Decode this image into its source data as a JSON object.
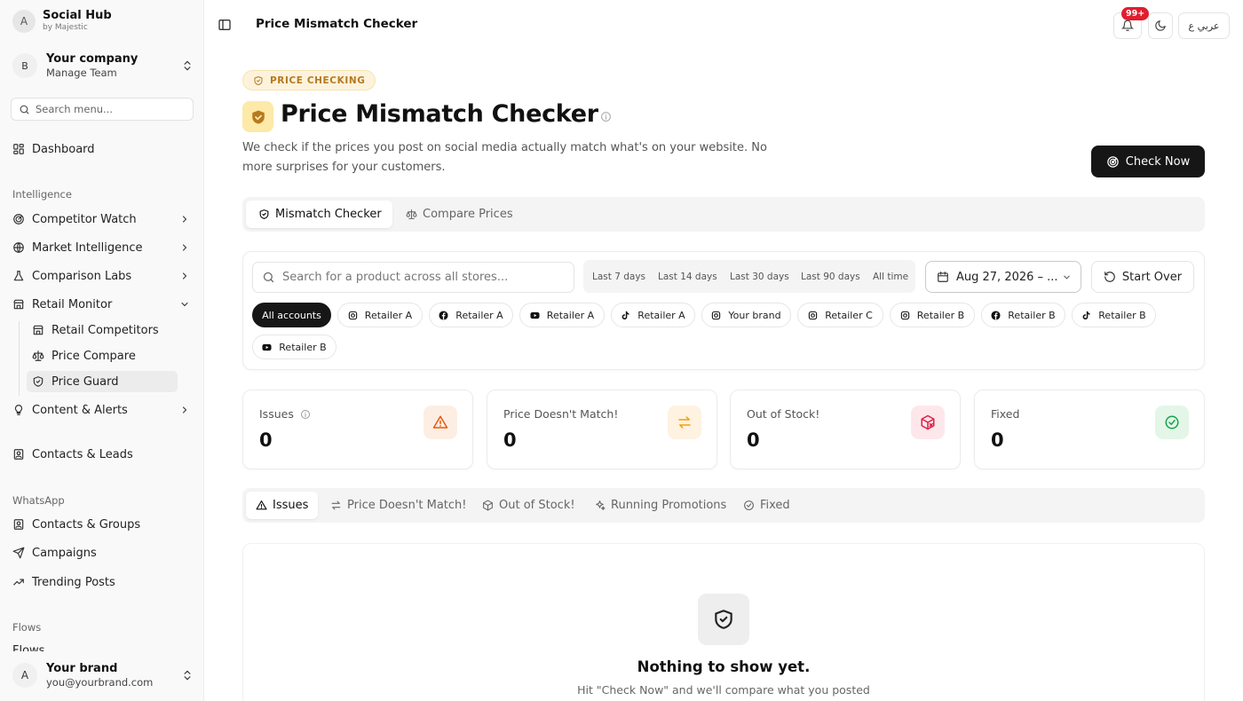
{
  "brand": {
    "avatar": "A",
    "name": "Social Hub",
    "by": "by Majestic"
  },
  "company": {
    "avatar": "B",
    "name": "Your company",
    "sub": "Manage Team"
  },
  "side_search": {
    "placeholder": "Search menu..."
  },
  "nav": {
    "dashboard": "Dashboard",
    "intelligence_label": "Intelligence",
    "competitor_watch": "Competitor Watch",
    "market_intelligence": "Market Intelligence",
    "comparison_labs": "Comparison Labs",
    "retail_monitor": "Retail Monitor",
    "retail_competitors": "Retail Competitors",
    "price_compare": "Price Compare",
    "price_guard": "Price Guard",
    "content_alerts": "Content & Alerts",
    "contacts_leads": "Contacts & Leads",
    "whatsapp_label": "WhatsApp",
    "contacts_groups": "Contacts & Groups",
    "campaigns": "Campaigns",
    "trending_posts": "Trending Posts",
    "flows_label": "Flows",
    "flows_item": "Flows"
  },
  "user": {
    "avatar": "A",
    "name": "Your brand",
    "email": "you@yourbrand.com"
  },
  "header": {
    "title": "Price Mismatch Checker",
    "badge": "99+",
    "lang": "عربي ع"
  },
  "page": {
    "pill": "PRICE CHECKING",
    "title": "Price Mismatch Checker",
    "description": "We check if the prices you post on social media actually match what's on your website. No more surprises for your customers.",
    "check_now": "Check Now"
  },
  "tabs": [
    "Mismatch Checker",
    "Compare Prices"
  ],
  "filters": {
    "search_placeholder": "Search for a product across all stores...",
    "ranges": [
      "Last 7 days",
      "Last 14 days",
      "Last 30 days",
      "Last 90 days",
      "All time"
    ],
    "date": "Aug 27, 2026 – ...",
    "start_over": "Start Over"
  },
  "accounts": [
    {
      "label": "All accounts",
      "icon": "none"
    },
    {
      "label": "Retailer A",
      "icon": "instagram-icon"
    },
    {
      "label": "Retailer A",
      "icon": "facebook-icon"
    },
    {
      "label": "Retailer A",
      "icon": "youtube-icon"
    },
    {
      "label": "Retailer A",
      "icon": "tiktok-icon"
    },
    {
      "label": "Your brand",
      "icon": "instagram-icon"
    },
    {
      "label": "Retailer C",
      "icon": "instagram-icon"
    },
    {
      "label": "Retailer B",
      "icon": "instagram-icon"
    },
    {
      "label": "Retailer B",
      "icon": "facebook-icon"
    },
    {
      "label": "Retailer B",
      "icon": "tiktok-icon"
    },
    {
      "label": "Retailer B",
      "icon": "youtube-icon"
    }
  ],
  "stats": [
    {
      "label": "Issues",
      "value": "0",
      "color": "#ea580c",
      "bg": "#fdeee3"
    },
    {
      "label": "Price Doesn't Match!",
      "value": "0",
      "color": "#f59e0b",
      "bg": "#fef2e0"
    },
    {
      "label": "Out of Stock!",
      "value": "0",
      "color": "#e11d48",
      "bg": "#fde7ea"
    },
    {
      "label": "Fixed",
      "value": "0",
      "color": "#16a34a",
      "bg": "#e3f6e8"
    }
  ],
  "status_tabs": [
    "Issues",
    "Price Doesn't Match!",
    "Out of Stock!",
    "Running Promotions",
    "Fixed"
  ],
  "empty": {
    "title": "Nothing to show yet.",
    "subtitle": "Hit \"Check Now\" and we'll compare what you posted"
  }
}
